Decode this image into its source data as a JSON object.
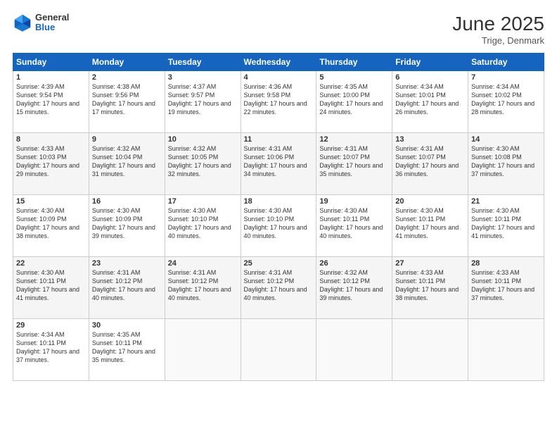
{
  "logo": {
    "general": "General",
    "blue": "Blue"
  },
  "title": "June 2025",
  "subtitle": "Trige, Denmark",
  "days_of_week": [
    "Sunday",
    "Monday",
    "Tuesday",
    "Wednesday",
    "Thursday",
    "Friday",
    "Saturday"
  ],
  "weeks": [
    [
      {
        "day": "1",
        "info": "Sunrise: 4:39 AM\nSunset: 9:54 PM\nDaylight: 17 hours and 15 minutes."
      },
      {
        "day": "2",
        "info": "Sunrise: 4:38 AM\nSunset: 9:56 PM\nDaylight: 17 hours and 17 minutes."
      },
      {
        "day": "3",
        "info": "Sunrise: 4:37 AM\nSunset: 9:57 PM\nDaylight: 17 hours and 19 minutes."
      },
      {
        "day": "4",
        "info": "Sunrise: 4:36 AM\nSunset: 9:58 PM\nDaylight: 17 hours and 22 minutes."
      },
      {
        "day": "5",
        "info": "Sunrise: 4:35 AM\nSunset: 10:00 PM\nDaylight: 17 hours and 24 minutes."
      },
      {
        "day": "6",
        "info": "Sunrise: 4:34 AM\nSunset: 10:01 PM\nDaylight: 17 hours and 26 minutes."
      },
      {
        "day": "7",
        "info": "Sunrise: 4:34 AM\nSunset: 10:02 PM\nDaylight: 17 hours and 28 minutes."
      }
    ],
    [
      {
        "day": "8",
        "info": "Sunrise: 4:33 AM\nSunset: 10:03 PM\nDaylight: 17 hours and 29 minutes."
      },
      {
        "day": "9",
        "info": "Sunrise: 4:32 AM\nSunset: 10:04 PM\nDaylight: 17 hours and 31 minutes."
      },
      {
        "day": "10",
        "info": "Sunrise: 4:32 AM\nSunset: 10:05 PM\nDaylight: 17 hours and 32 minutes."
      },
      {
        "day": "11",
        "info": "Sunrise: 4:31 AM\nSunset: 10:06 PM\nDaylight: 17 hours and 34 minutes."
      },
      {
        "day": "12",
        "info": "Sunrise: 4:31 AM\nSunset: 10:07 PM\nDaylight: 17 hours and 35 minutes."
      },
      {
        "day": "13",
        "info": "Sunrise: 4:31 AM\nSunset: 10:07 PM\nDaylight: 17 hours and 36 minutes."
      },
      {
        "day": "14",
        "info": "Sunrise: 4:30 AM\nSunset: 10:08 PM\nDaylight: 17 hours and 37 minutes."
      }
    ],
    [
      {
        "day": "15",
        "info": "Sunrise: 4:30 AM\nSunset: 10:09 PM\nDaylight: 17 hours and 38 minutes."
      },
      {
        "day": "16",
        "info": "Sunrise: 4:30 AM\nSunset: 10:09 PM\nDaylight: 17 hours and 39 minutes."
      },
      {
        "day": "17",
        "info": "Sunrise: 4:30 AM\nSunset: 10:10 PM\nDaylight: 17 hours and 40 minutes."
      },
      {
        "day": "18",
        "info": "Sunrise: 4:30 AM\nSunset: 10:10 PM\nDaylight: 17 hours and 40 minutes."
      },
      {
        "day": "19",
        "info": "Sunrise: 4:30 AM\nSunset: 10:11 PM\nDaylight: 17 hours and 40 minutes."
      },
      {
        "day": "20",
        "info": "Sunrise: 4:30 AM\nSunset: 10:11 PM\nDaylight: 17 hours and 41 minutes."
      },
      {
        "day": "21",
        "info": "Sunrise: 4:30 AM\nSunset: 10:11 PM\nDaylight: 17 hours and 41 minutes."
      }
    ],
    [
      {
        "day": "22",
        "info": "Sunrise: 4:30 AM\nSunset: 10:11 PM\nDaylight: 17 hours and 41 minutes."
      },
      {
        "day": "23",
        "info": "Sunrise: 4:31 AM\nSunset: 10:12 PM\nDaylight: 17 hours and 40 minutes."
      },
      {
        "day": "24",
        "info": "Sunrise: 4:31 AM\nSunset: 10:12 PM\nDaylight: 17 hours and 40 minutes."
      },
      {
        "day": "25",
        "info": "Sunrise: 4:31 AM\nSunset: 10:12 PM\nDaylight: 17 hours and 40 minutes."
      },
      {
        "day": "26",
        "info": "Sunrise: 4:32 AM\nSunset: 10:12 PM\nDaylight: 17 hours and 39 minutes."
      },
      {
        "day": "27",
        "info": "Sunrise: 4:33 AM\nSunset: 10:11 PM\nDaylight: 17 hours and 38 minutes."
      },
      {
        "day": "28",
        "info": "Sunrise: 4:33 AM\nSunset: 10:11 PM\nDaylight: 17 hours and 37 minutes."
      }
    ],
    [
      {
        "day": "29",
        "info": "Sunrise: 4:34 AM\nSunset: 10:11 PM\nDaylight: 17 hours and 37 minutes."
      },
      {
        "day": "30",
        "info": "Sunrise: 4:35 AM\nSunset: 10:11 PM\nDaylight: 17 hours and 35 minutes."
      },
      {
        "day": "",
        "info": ""
      },
      {
        "day": "",
        "info": ""
      },
      {
        "day": "",
        "info": ""
      },
      {
        "day": "",
        "info": ""
      },
      {
        "day": "",
        "info": ""
      }
    ]
  ]
}
